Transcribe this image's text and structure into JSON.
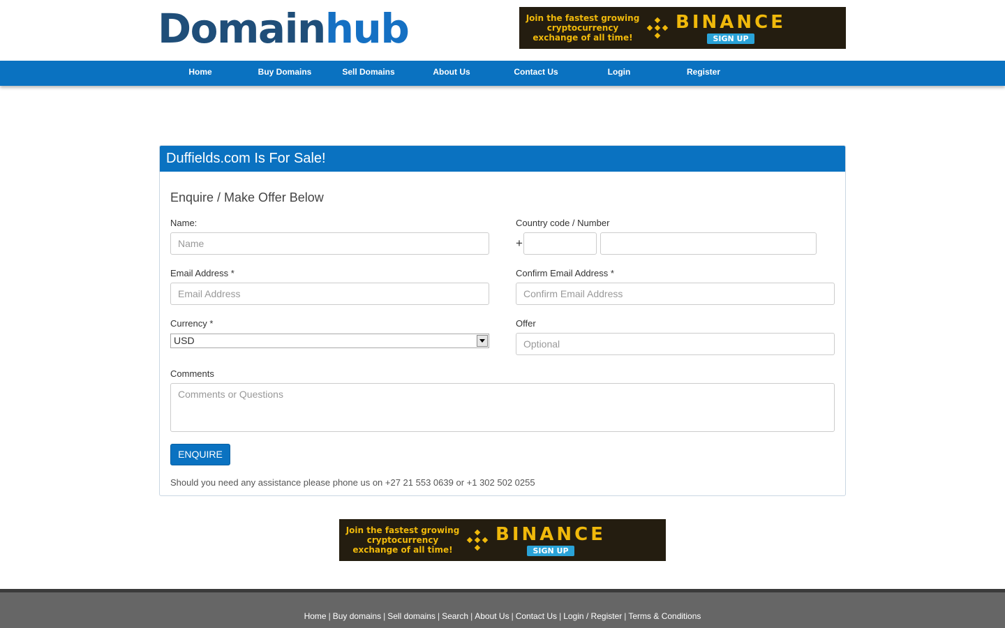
{
  "header": {
    "logo_part1": "Domain",
    "logo_part2": "hub"
  },
  "ads": {
    "top": {
      "tagline": "Join the fastest growing cryptocurrency exchange of all time!",
      "brand": "BINANCE",
      "cta": "SIGN UP"
    },
    "bottom": {
      "tagline": "Join the fastest growing cryptocurrency exchange of all time!",
      "brand": "BINANCE",
      "cta": "SIGN UP"
    }
  },
  "nav": {
    "items": [
      {
        "label": "Home"
      },
      {
        "label": "Buy Domains"
      },
      {
        "label": "Sell Domains"
      },
      {
        "label": "About Us"
      },
      {
        "label": "Contact Us"
      },
      {
        "label": "Login"
      },
      {
        "label": "Register"
      }
    ]
  },
  "panel": {
    "title": "Duffields.com Is For Sale!",
    "form_title": "Enquire / Make Offer Below",
    "name_label": "Name:",
    "name_placeholder": "Name",
    "phone_label": "Country code / Number",
    "phone_plus": "+",
    "email_label": "Email Address *",
    "email_placeholder": "Email Address",
    "confirm_email_label": "Confirm Email Address *",
    "confirm_email_placeholder": "Confirm Email Address",
    "currency_label": "Currency *",
    "currency_value": "USD",
    "offer_label": "Offer",
    "offer_placeholder": "Optional",
    "comments_label": "Comments",
    "comments_placeholder": "Comments or Questions",
    "button_label": "ENQUIRE",
    "assistance_text": "Should you need any assistance please phone us on +27 21 553 0639 or +1 302 502 0255"
  },
  "footer": {
    "links": [
      {
        "label": "Home"
      },
      {
        "label": "Buy domains"
      },
      {
        "label": "Sell domains"
      },
      {
        "label": "Search"
      },
      {
        "label": "About Us"
      },
      {
        "label": "Contact Us"
      },
      {
        "label": "Login / Register"
      },
      {
        "label": "Terms & Conditions"
      }
    ],
    "separator": "|"
  },
  "colors": {
    "brand_blue": "#0a72c1",
    "logo_dark": "#1f4e79",
    "ad_gold": "#f0b90b",
    "footer_gray": "#666666"
  }
}
